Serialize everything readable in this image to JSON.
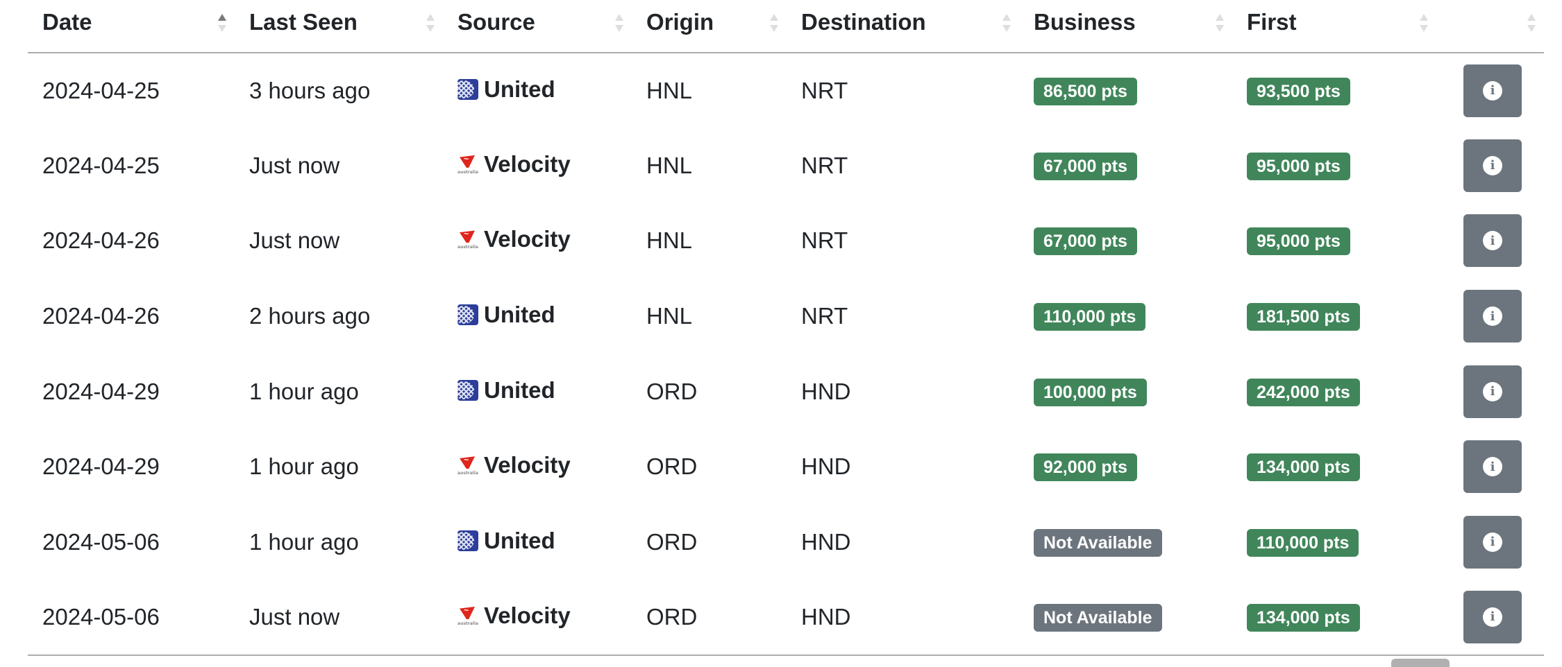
{
  "table": {
    "columns": [
      {
        "label": "Date",
        "sort": "asc"
      },
      {
        "label": "Last Seen",
        "sort": "none"
      },
      {
        "label": "Source",
        "sort": "none"
      },
      {
        "label": "Origin",
        "sort": "none"
      },
      {
        "label": "Destination",
        "sort": "none"
      },
      {
        "label": "Business",
        "sort": "none"
      },
      {
        "label": "First",
        "sort": "none"
      },
      {
        "label": "",
        "sort": "none"
      }
    ],
    "rows": [
      {
        "date": "2024-04-25",
        "last_seen": "3 hours ago",
        "source": "United",
        "source_icon": "united-logo-icon",
        "origin": "HNL",
        "destination": "NRT",
        "business": "86,500 pts",
        "business_available": true,
        "first": "93,500 pts",
        "first_available": true
      },
      {
        "date": "2024-04-25",
        "last_seen": "Just now",
        "source": "Velocity",
        "source_icon": "virgin-australia-logo-icon",
        "origin": "HNL",
        "destination": "NRT",
        "business": "67,000 pts",
        "business_available": true,
        "first": "95,000 pts",
        "first_available": true
      },
      {
        "date": "2024-04-26",
        "last_seen": "Just now",
        "source": "Velocity",
        "source_icon": "virgin-australia-logo-icon",
        "origin": "HNL",
        "destination": "NRT",
        "business": "67,000 pts",
        "business_available": true,
        "first": "95,000 pts",
        "first_available": true
      },
      {
        "date": "2024-04-26",
        "last_seen": "2 hours ago",
        "source": "United",
        "source_icon": "united-logo-icon",
        "origin": "HNL",
        "destination": "NRT",
        "business": "110,000 pts",
        "business_available": true,
        "first": "181,500 pts",
        "first_available": true
      },
      {
        "date": "2024-04-29",
        "last_seen": "1 hour ago",
        "source": "United",
        "source_icon": "united-logo-icon",
        "origin": "ORD",
        "destination": "HND",
        "business": "100,000 pts",
        "business_available": true,
        "first": "242,000 pts",
        "first_available": true
      },
      {
        "date": "2024-04-29",
        "last_seen": "1 hour ago",
        "source": "Velocity",
        "source_icon": "virgin-australia-logo-icon",
        "origin": "ORD",
        "destination": "HND",
        "business": "92,000 pts",
        "business_available": true,
        "first": "134,000 pts",
        "first_available": true
      },
      {
        "date": "2024-05-06",
        "last_seen": "1 hour ago",
        "source": "United",
        "source_icon": "united-logo-icon",
        "origin": "ORD",
        "destination": "HND",
        "business": "Not Available",
        "business_available": false,
        "first": "110,000 pts",
        "first_available": true
      },
      {
        "date": "2024-05-06",
        "last_seen": "Just now",
        "source": "Velocity",
        "source_icon": "virgin-australia-logo-icon",
        "origin": "ORD",
        "destination": "HND",
        "business": "Not Available",
        "business_available": false,
        "first": "134,000 pts",
        "first_available": true
      }
    ],
    "info_icon": "info-circle-icon",
    "virgin_wordmark": "australia"
  },
  "colors": {
    "available_badge": "#40865a",
    "unavailable_badge": "#6c757d",
    "info_button": "#6c757d",
    "united_blue": "#2c3e9a",
    "virgin_red": "#e0261c"
  }
}
